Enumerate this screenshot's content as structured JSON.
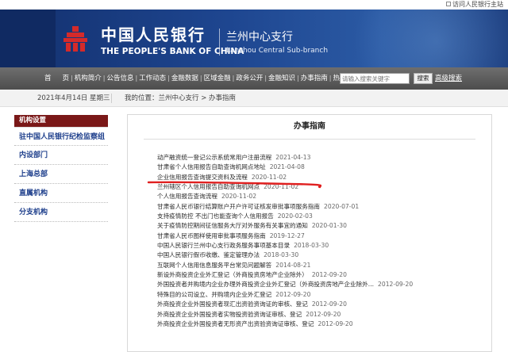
{
  "top_link": {
    "label": "访问人民银行主站",
    "icon": "globe-icon"
  },
  "header": {
    "bank_name_cn": "中国人民银行",
    "bank_name_en": "THE PEOPLE'S BANK OF CHINA",
    "branch_cn": "兰州中心支行",
    "branch_en": "Lanzhou  Central  Sub-branch",
    "colors": {
      "header_bg": "#1e4690",
      "sidebar_head": "#7a1818",
      "link": "#1e3f8c",
      "annotation": "#e02020"
    }
  },
  "nav": {
    "items": [
      "首",
      "页",
      "机构简介",
      "公告信息",
      "工作动态",
      "金融数据",
      "区域金融",
      "政务公开",
      "金融知识",
      "办事指南",
      "热点专题"
    ],
    "search_placeholder": "请输入搜索关键字",
    "search_button": "搜索",
    "advanced_search": "高级搜索"
  },
  "crumbbar": {
    "date": "2021年4月14日 星期三",
    "breadcrumb": "我的位置：兰州中心支行  >  办事指南"
  },
  "sidebar": {
    "heading": "机构设置",
    "items": [
      "驻中国人民银行纪检监察组",
      "内设部门",
      "上海总部",
      "直属机构",
      "分支机构"
    ]
  },
  "main": {
    "title": "办事指南",
    "list": [
      {
        "title": "动产融资统一登记公示系统常用户注册流程",
        "date": "2021-04-13"
      },
      {
        "title": "甘肃省个人信用报告自助查询机网点地址",
        "date": "2021-04-08"
      },
      {
        "title": "企业信用报告查询提交资料及流程",
        "date": "2020-11-02"
      },
      {
        "title": "兰州辖区个人信用报告自助查询机网点",
        "date": "2020-11-02"
      },
      {
        "title": "个人信用报告查询流程",
        "date": "2020-11-02"
      },
      {
        "title": "甘肃省人民币银行结算账户开户许可证核发审批事项服务指南",
        "date": "2020-07-01"
      },
      {
        "title": "支持疫情防控  不出门也能查询个人信用报告",
        "date": "2020-02-03"
      },
      {
        "title": "关于疫情防控期间征信服务大厅对外服务有关事宜的通知",
        "date": "2020-01-30"
      },
      {
        "title": "甘肃省人民币图样使用审批事项服务指南",
        "date": "2019-12-27"
      },
      {
        "title": "中国人民银行兰州中心支行政务服务事项基本目录",
        "date": "2018-03-30"
      },
      {
        "title": "中国人民银行假币收缴、鉴定管理办法",
        "date": "2018-03-30"
      },
      {
        "title": "互联网个人信用信息服务平台常见问题解答",
        "date": "2014-08-21"
      },
      {
        "title": "新设外商投资企业外汇登记（外商投资房地产企业除外）",
        "date": "2012-09-20"
      },
      {
        "title": "外国投资者并购境内企业办理外商投资企业外汇登记（外商投资房地产企业除外...",
        "date": "2012-09-20"
      },
      {
        "title": "特殊目的公司设立、并购境内企业外汇登记",
        "date": "2012-09-20"
      },
      {
        "title": "外商投资企业外国投资者现汇出资验资询证的审核、登记",
        "date": "2012-09-20"
      },
      {
        "title": "外商投资企业外国投资者实物投资验资询证审核、登记",
        "date": "2012-09-20"
      },
      {
        "title": "外商投资企业外国投资者无形资产出资验资询证审核、登记",
        "date": "2012-09-20"
      }
    ]
  }
}
